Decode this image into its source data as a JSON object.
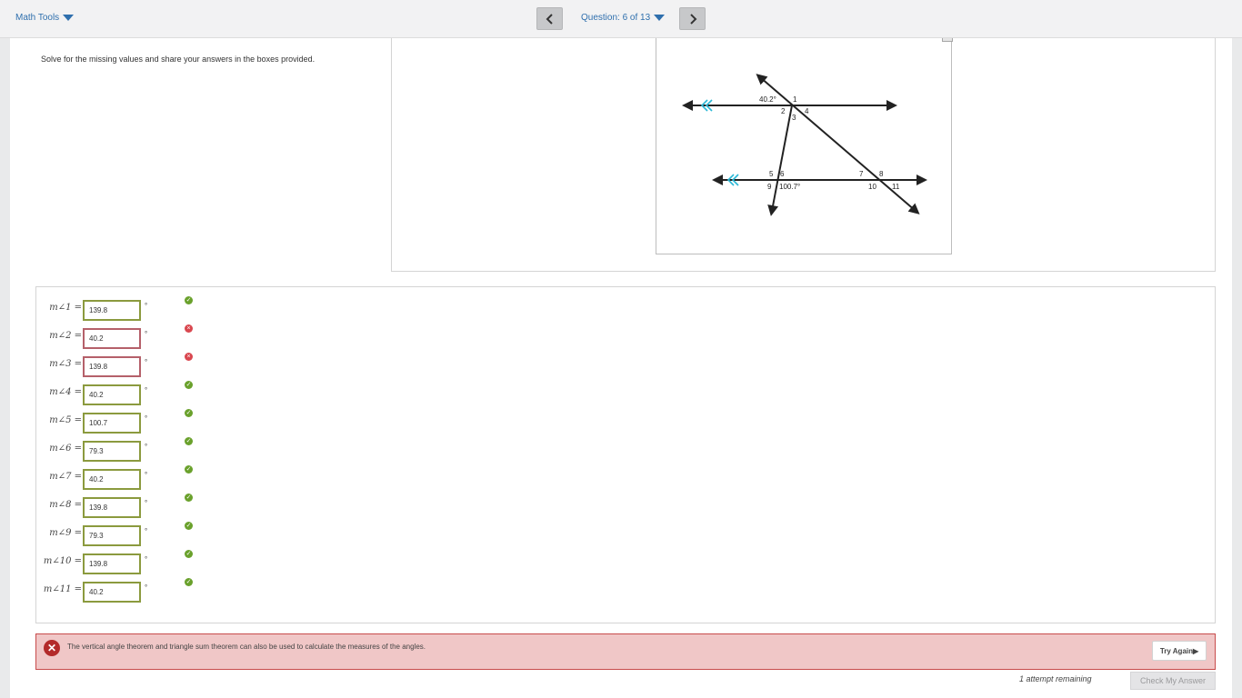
{
  "topbar": {
    "math_tools_label": "Math Tools",
    "question_label": "Question: 6 of 13"
  },
  "prompt": "Solve for the missing values and share your answers in the boxes provided.",
  "figure": {
    "labels": {
      "angle_given_top": "40.2°",
      "n1": "1",
      "n2": "2",
      "n3": "3",
      "n4": "4",
      "n5": "5",
      "n6": "6",
      "n7": "7",
      "n8": "8",
      "n9": "9",
      "n10": "10",
      "n11": "11",
      "angle_given_bottom": "100.7°"
    },
    "parallel_mark_color": "#2bb8d6"
  },
  "answers": [
    {
      "label": "m∠1 =",
      "value": "139.8",
      "status": "correct"
    },
    {
      "label": "m∠2 =",
      "value": "40.2",
      "status": "wrong"
    },
    {
      "label": "m∠3 =",
      "value": "139.8",
      "status": "wrong"
    },
    {
      "label": "m∠4 =",
      "value": "40.2",
      "status": "correct"
    },
    {
      "label": "m∠5 =",
      "value": "100.7",
      "status": "correct"
    },
    {
      "label": "m∠6 =",
      "value": "79.3",
      "status": "correct"
    },
    {
      "label": "m∠7 =",
      "value": "40.2",
      "status": "correct"
    },
    {
      "label": "m∠8 =",
      "value": "139.8",
      "status": "correct"
    },
    {
      "label": "m∠9 =",
      "value": "79.3",
      "status": "correct"
    },
    {
      "label": "m∠10 =",
      "value": "139.8",
      "status": "correct"
    },
    {
      "label": "m∠11 =",
      "value": "40.2",
      "status": "correct"
    }
  ],
  "degree_symbol": "°",
  "feedback": {
    "text": "The vertical angle theorem and triangle sum theorem can also be used to calculate the measures of the angles.",
    "try_again_label": "Try Again▶"
  },
  "footer": {
    "attempts_text": "1 attempt remaining",
    "check_label": "Check My Answer"
  },
  "colors": {
    "correct": "#6aa12c",
    "wrong": "#d9474f",
    "feedback_bg": "#f0c7c7"
  }
}
